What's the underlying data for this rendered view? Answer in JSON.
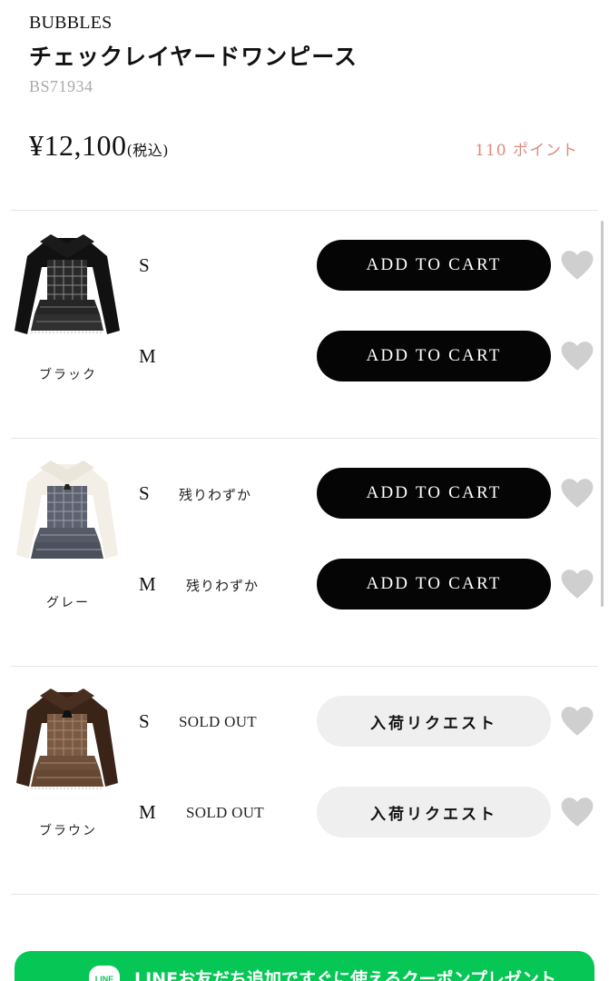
{
  "product": {
    "brand": "BUBBLES",
    "title": "チェックレイヤードワンピース",
    "code": "BS71934",
    "price": "¥12,100",
    "tax_note": "(税込)",
    "points": "110 ポイント"
  },
  "variants": [
    {
      "color_name": "ブラック",
      "sizes": [
        {
          "size": "S",
          "stock": "",
          "button": "ADD TO CART"
        },
        {
          "size": "M",
          "stock": "",
          "button": "ADD TO CART"
        }
      ]
    },
    {
      "color_name": "グレー",
      "sizes": [
        {
          "size": "S",
          "stock": "残りわずか",
          "button": "ADD TO CART"
        },
        {
          "size": "M",
          "stock": "残りわずか",
          "button": "ADD TO CART"
        }
      ]
    },
    {
      "color_name": "ブラウン",
      "sizes": [
        {
          "size": "S",
          "stock": "SOLD OUT",
          "button": "入荷リクエスト"
        },
        {
          "size": "M",
          "stock": "SOLD OUT",
          "button": "入荷リクエスト"
        }
      ]
    }
  ],
  "banner": {
    "logo_text": "LINE",
    "text": "LINEお友だち追加ですぐに使えるクーポンプレゼント"
  },
  "colors": {
    "cart_button": "#050505",
    "request_button": "#efefef",
    "points": "#d98b7c",
    "heart": "#cfcfcf",
    "line_green": "#06c755"
  }
}
